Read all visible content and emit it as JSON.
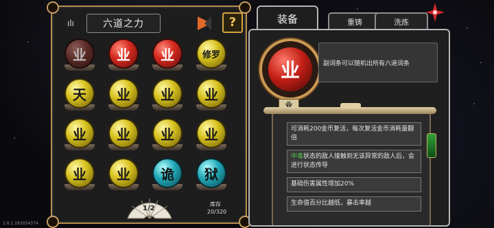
{
  "left_panel": {
    "title": "六道之力",
    "help_label": "?",
    "orbs": [
      {
        "label": "业",
        "color": "dim"
      },
      {
        "label": "业",
        "color": "red"
      },
      {
        "label": "业",
        "color": "red"
      },
      {
        "label": "修罗",
        "color": "yellow"
      },
      {
        "label": "天",
        "color": "yellow"
      },
      {
        "label": "业",
        "color": "yellow"
      },
      {
        "label": "业",
        "color": "yellow"
      },
      {
        "label": "业",
        "color": "yellow"
      },
      {
        "label": "业",
        "color": "yellow"
      },
      {
        "label": "业",
        "color": "yellow"
      },
      {
        "label": "业",
        "color": "yellow"
      },
      {
        "label": "业",
        "color": "yellow"
      },
      {
        "label": "业",
        "color": "yellow"
      },
      {
        "label": "业",
        "color": "yellow"
      },
      {
        "label": "诡",
        "color": "teal"
      },
      {
        "label": "狱",
        "color": "teal"
      }
    ],
    "page_indicator": "1/2",
    "stock_label": "库存",
    "stock_value": "20/320"
  },
  "tabs": {
    "equip": "装备",
    "recast": "重铸",
    "wash": "洗炼"
  },
  "right_panel": {
    "big_orb_label": "业",
    "big_orb_tag": "业",
    "description": "副词条可以随机出所有六道词条",
    "affixes": [
      {
        "text": "可消耗200金币复活，每次复活金币消耗量翻倍"
      },
      {
        "highlight": "中毒",
        "text": "状态的敌人接触到无该异常的敌人后，会进行状态传导"
      },
      {
        "text": "基础伤害属性增加20%"
      },
      {
        "text": "生命值百分比越低，暴击率越"
      }
    ]
  },
  "footer": {
    "version": "2.8.1.183054374"
  }
}
